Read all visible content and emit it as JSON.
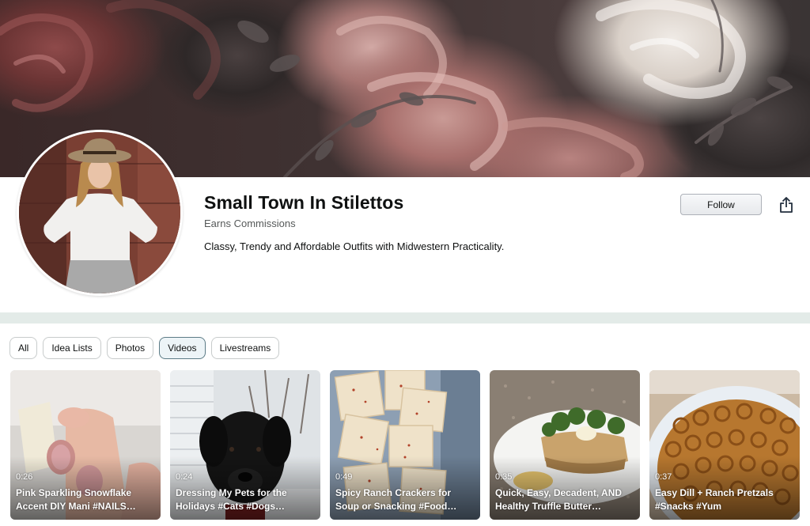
{
  "profile": {
    "name": "Small Town In Stilettos",
    "earns": "Earns Commissions",
    "bio": "Classy, Trendy and Affordable Outfits with Midwestern Practicality."
  },
  "actions": {
    "follow_label": "Follow",
    "share_icon": "share-icon"
  },
  "filters": [
    "All",
    "Idea Lists",
    "Photos",
    "Videos",
    "Livestreams"
  ],
  "active_filter": "Videos",
  "videos": [
    {
      "duration": "0:26",
      "title": "Pink Sparkling Snowflake Accent DIY Mani #NAILS…"
    },
    {
      "duration": "0:24",
      "title": "Dressing My Pets for the Holidays #Cats #Dogs…"
    },
    {
      "duration": "0:49",
      "title": "Spicy Ranch Crackers for Soup or Snacking #Food…"
    },
    {
      "duration": "0:35",
      "title": "Quick, Easy, Decadent, AND Healthy Truffle Butter…"
    },
    {
      "duration": "0:37",
      "title": "Easy Dill + Ranch Pretzals #Snacks #Yum"
    }
  ],
  "colors": {
    "active_chip_bg": "#edf4f7",
    "divider": "#e3ebe8",
    "text": "#0f1111",
    "muted_text": "#565959"
  }
}
